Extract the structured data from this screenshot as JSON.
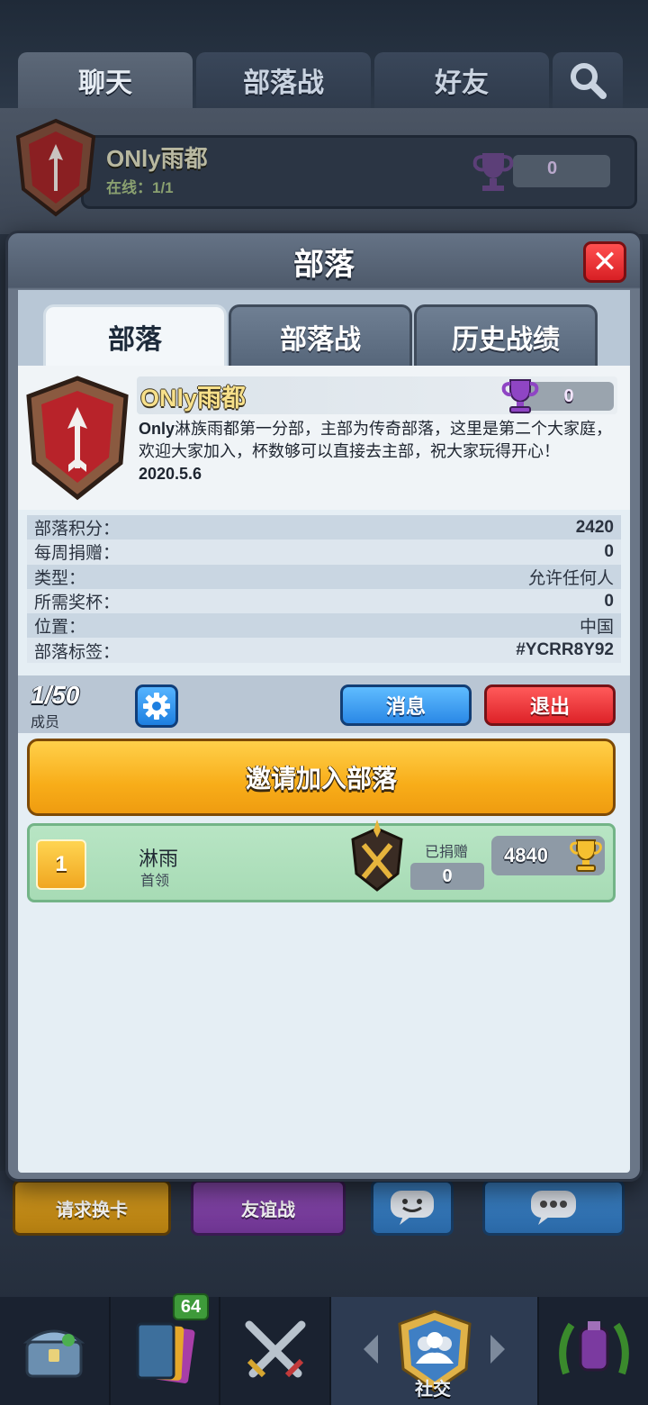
{
  "background": {
    "top_tabs": [
      "聊天",
      "部落战",
      "好友"
    ],
    "clan_bar": {
      "name": "ONly雨都",
      "online": "在线：1/1",
      "trophies": "0"
    },
    "bottom_buttons": [
      "请求换卡",
      "友谊战"
    ],
    "nav": {
      "cards_badge": "64",
      "social_label": "社交"
    }
  },
  "modal": {
    "title": "部落",
    "close_glyph": "✕",
    "tabs": [
      "部落",
      "部落战",
      "历史战绩"
    ],
    "clan": {
      "name": "ONly雨都",
      "trophies": "0",
      "desc_lead": "Only",
      "desc_body": "淋族雨都第一分部，主部为传奇部落，这里是第二个大家庭，欢迎大家加入，杯数够可以直接去主部，祝大家玩得开心！",
      "desc_date": "2020.5.6"
    },
    "stats": [
      {
        "label": "部落积分：",
        "value": "2420"
      },
      {
        "label": "每周捐赠：",
        "value": "0"
      },
      {
        "label": "类型：",
        "value": "允许任何人"
      },
      {
        "label": "所需奖杯：",
        "value": "0"
      },
      {
        "label": "位置：",
        "value": "中国"
      },
      {
        "label": "部落标签：",
        "value": "#YCRR8Y92"
      }
    ],
    "members_count": "1/50",
    "members_label": "成员",
    "message_button": "消息",
    "leave_button": "退出",
    "invite_button": "邀请加入部落",
    "members": [
      {
        "rank": "1",
        "name": "淋雨",
        "role": "首领",
        "donated_label": "已捐赠",
        "donated": "0",
        "trophies": "4840"
      }
    ]
  },
  "colors": {
    "accent_gold": "#f8ad19",
    "button_blue": "#2a88e6",
    "button_red": "#dd2228",
    "member_row": "#a7dbb5"
  }
}
